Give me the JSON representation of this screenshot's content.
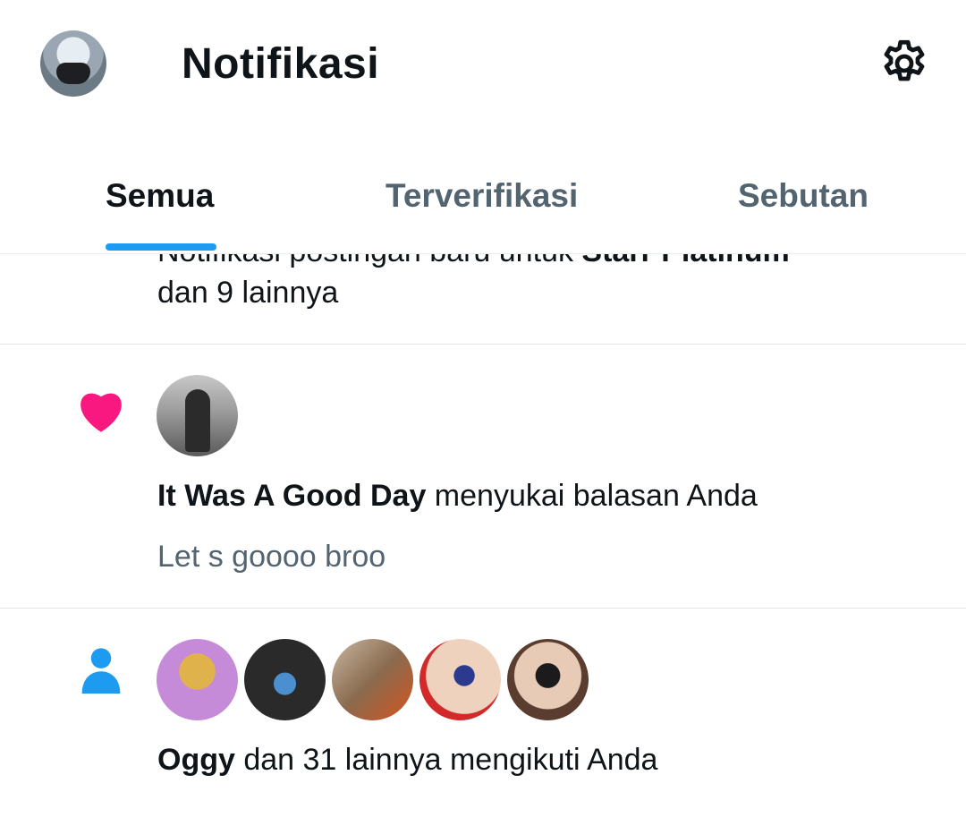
{
  "header": {
    "title": "Notifikasi",
    "avatar_icon": "user-avatar",
    "settings_icon": "gear-icon"
  },
  "tabs": [
    {
      "label": "Semua",
      "active": true
    },
    {
      "label": "Terverifikasi",
      "active": false
    },
    {
      "label": "Sebutan",
      "active": false
    }
  ],
  "colors": {
    "accent": "#1d9bf0",
    "like": "#f91880",
    "text": "#0f1419",
    "secondary_text": "#536471"
  },
  "notifications": [
    {
      "type": "new-post",
      "text_prefix": "Notifikasi postingan baru untuk ",
      "bold_name": "Starr Platinum",
      "text_suffix": "dan 9 lainnya"
    },
    {
      "type": "like",
      "icon": "heart-icon",
      "bold_name": "It Was A Good Day",
      "action": " menyukai balasan Anda",
      "preview": "Let s goooo broo"
    },
    {
      "type": "follow",
      "icon": "person-icon",
      "avatar_count": 5,
      "bold_name": "Oggy",
      "action": " dan 31 lainnya mengikuti Anda"
    }
  ]
}
